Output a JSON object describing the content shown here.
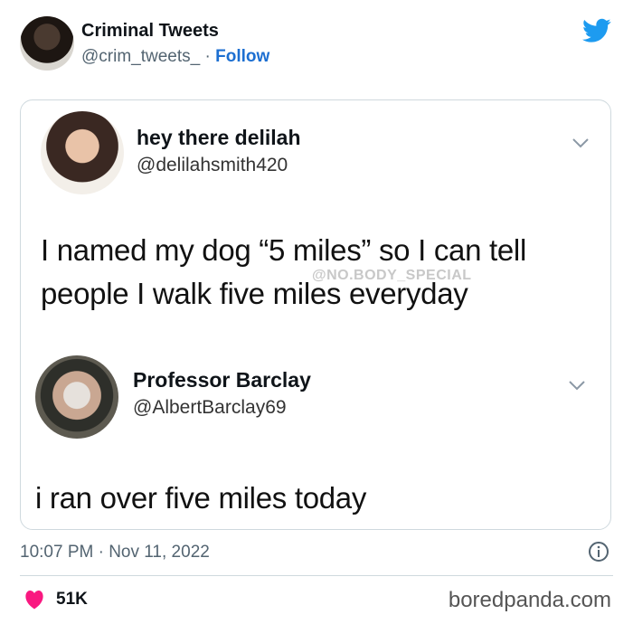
{
  "author": {
    "name": "Criminal Tweets",
    "handle": "@crim_tweets_",
    "separator": "·",
    "follow_label": "Follow"
  },
  "quoted_posts": [
    {
      "name": "hey there delilah",
      "handle": "@delilahsmith420",
      "text": "I named my dog “5 miles” so I can tell people I walk five miles everyday",
      "watermark": "@NO.BODY_SPECIAL"
    },
    {
      "name": "Professor Barclay",
      "handle": "@AlbertBarclay69",
      "text": "i ran over five miles today"
    }
  ],
  "meta": {
    "timestamp": "10:07 PM · Nov 11, 2022"
  },
  "actions": {
    "like_count": "51K"
  },
  "source": "boredpanda.com",
  "colors": {
    "twitter_blue": "#1d9bf0",
    "follow_blue": "#1d6fd1",
    "heart": "#f91880"
  }
}
